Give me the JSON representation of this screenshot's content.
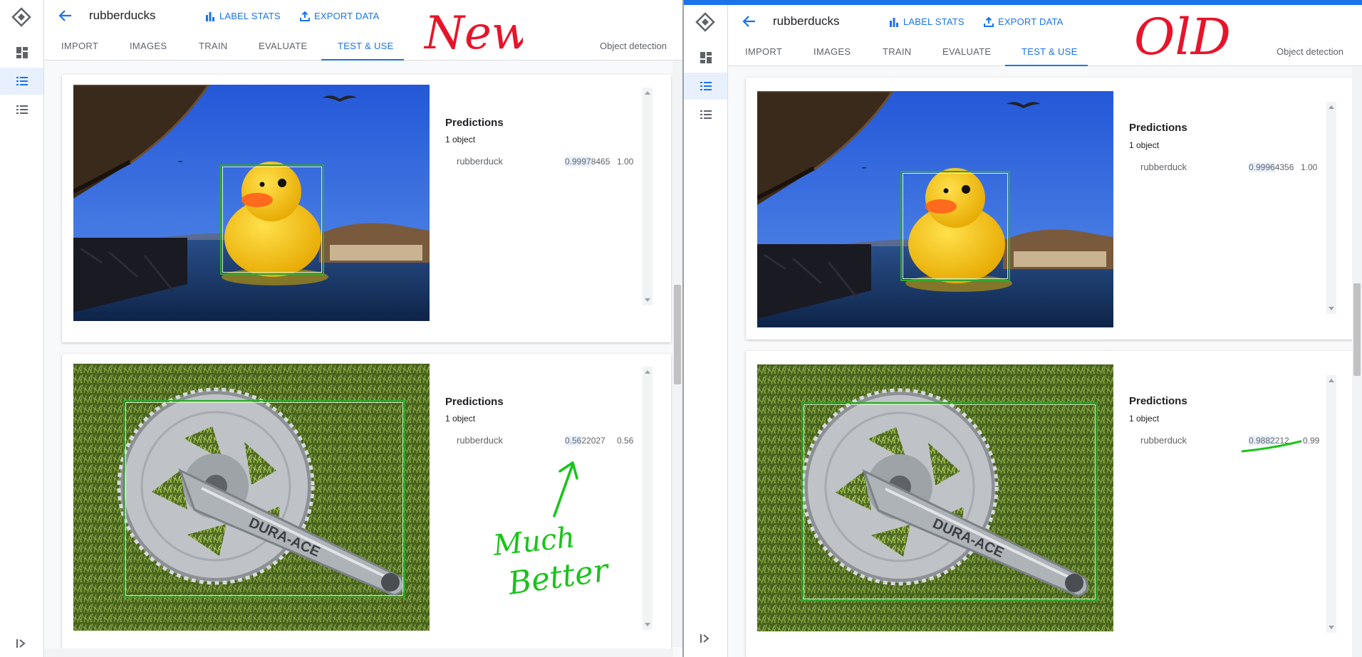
{
  "app": {
    "title": "rubberducks",
    "label_stats": "LABEL STATS",
    "export_data": "EXPORT DATA",
    "mode": "Object detection"
  },
  "tabs": [
    "IMPORT",
    "IMAGES",
    "TRAIN",
    "EVALUATE",
    "TEST & USE"
  ],
  "active_tab": "TEST & USE",
  "colors": {
    "accent": "#1a73e8",
    "ink_red": "#e8142a",
    "ink_green": "#18c418",
    "box_green": "#2fa82f"
  },
  "panes": {
    "new": {
      "annotation": "New",
      "comment": {
        "line1": "Much",
        "line2": "Better"
      },
      "cards": [
        {
          "image": "rubber-duck",
          "predictions_title": "Predictions",
          "count": "1 object",
          "label": "rubberduck",
          "score_hl": "0.9997",
          "score_rest": "8465",
          "score_rounded": "1.00"
        },
        {
          "image": "bike-crankset",
          "predictions_title": "Predictions",
          "count": "1 object",
          "label": "rubberduck",
          "score_hl": "0.56",
          "score_rest": "22027",
          "score_rounded": "0.56"
        }
      ]
    },
    "old": {
      "annotation": "OlD",
      "cards": [
        {
          "image": "rubber-duck",
          "predictions_title": "Predictions",
          "count": "1 object",
          "label": "rubberduck",
          "score_hl": "0.9996",
          "score_rest": "4356",
          "score_rounded": "1.00"
        },
        {
          "image": "bike-crankset",
          "predictions_title": "Predictions",
          "count": "1 object",
          "label": "rubberduck",
          "score_hl": "0.9882",
          "score_rest": "212",
          "score_rounded": "0.99"
        }
      ]
    }
  }
}
